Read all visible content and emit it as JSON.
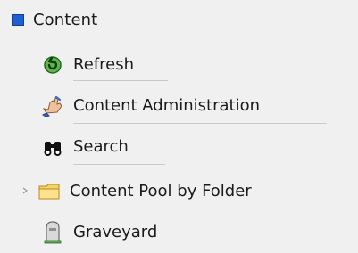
{
  "tree": {
    "root": {
      "label": "Content",
      "icon": "blue-square-icon"
    },
    "items": [
      {
        "label": "Refresh",
        "icon": "refresh-icon"
      },
      {
        "label": "Content Administration",
        "icon": "hand-icon"
      },
      {
        "label": "Search",
        "icon": "binoculars-icon"
      },
      {
        "label": "Content Pool by Folder",
        "icon": "folder-icon",
        "expander_icon": "chevron-right-icon"
      },
      {
        "label": "Graveyard",
        "icon": "tombstone-icon"
      }
    ]
  }
}
